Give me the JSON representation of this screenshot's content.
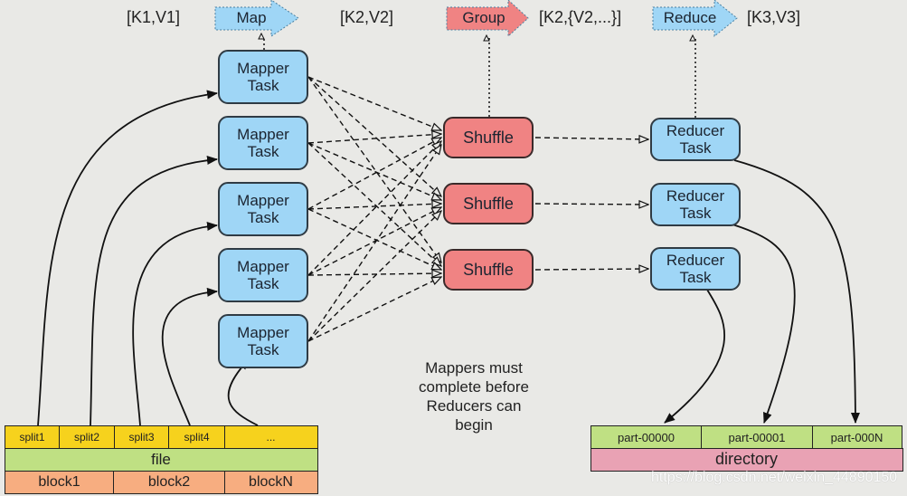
{
  "stages": {
    "k1v1": "[K1,V1]",
    "map": "Map",
    "k2v2": "[K2,V2]",
    "group": "Group",
    "k2list": "[K2,{V2,...}]",
    "reduce": "Reduce",
    "k3v3": "[K3,V3]"
  },
  "mappers": [
    {
      "line1": "Mapper",
      "line2": "Task"
    },
    {
      "line1": "Mapper",
      "line2": "Task"
    },
    {
      "line1": "Mapper",
      "line2": "Task"
    },
    {
      "line1": "Mapper",
      "line2": "Task"
    },
    {
      "line1": "Mapper",
      "line2": "Task"
    }
  ],
  "shuffles": [
    {
      "label": "Shuffle"
    },
    {
      "label": "Shuffle"
    },
    {
      "label": "Shuffle"
    }
  ],
  "reducers": [
    {
      "line1": "Reducer",
      "line2": "Task"
    },
    {
      "line1": "Reducer",
      "line2": "Task"
    },
    {
      "line1": "Reducer",
      "line2": "Task"
    }
  ],
  "note": {
    "lines": [
      "Mappers must",
      "complete before",
      "Reducers can",
      "begin"
    ]
  },
  "input_file": {
    "splits": [
      "split1",
      "split2",
      "split3",
      "split4",
      "..."
    ],
    "file_label": "file",
    "blocks": [
      "block1",
      "block2",
      "blockN"
    ]
  },
  "output_dir": {
    "parts": [
      "part-00000",
      "part-00001",
      "part-000N"
    ],
    "dir_label": "directory"
  },
  "watermark": "https://blog.csdn.net/weixin_44890150",
  "colors": {
    "mapper": "#9fd6f6",
    "reducer": "#9fd6f6",
    "shuffle": "#f08383",
    "split": "#f6d21d",
    "file": "#bfe083",
    "block": "#f7ad80",
    "part": "#bfe083",
    "directory": "#e9a2b4",
    "background": "#e9e9e6"
  }
}
